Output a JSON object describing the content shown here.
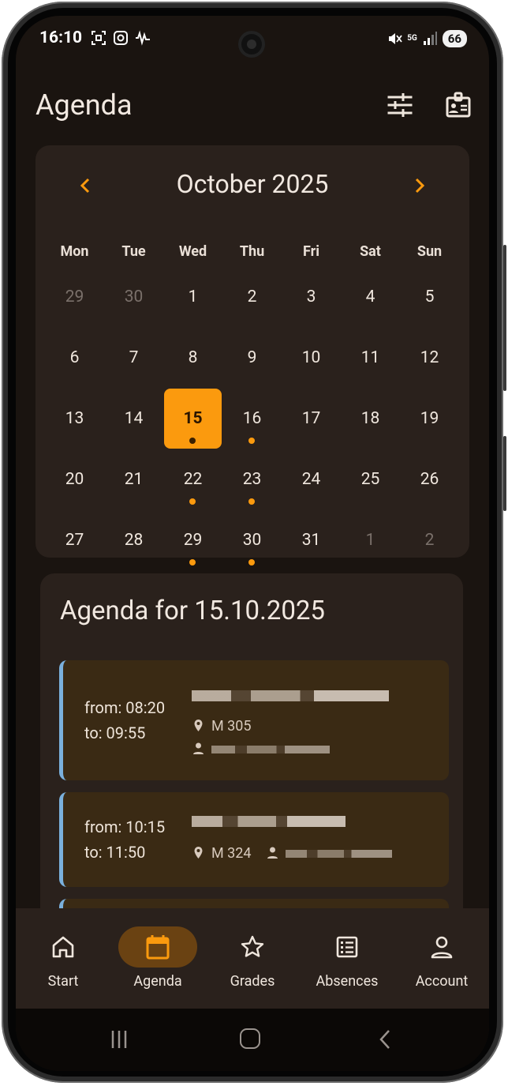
{
  "status_bar": {
    "time": "16:10",
    "network": "5G",
    "battery": "66"
  },
  "app_bar": {
    "title": "Agenda",
    "filter_icon": "tune-icon",
    "profile_icon": "badge-icon"
  },
  "calendar": {
    "month_label": "October 2025",
    "weekdays": [
      "Mon",
      "Tue",
      "Wed",
      "Thu",
      "Fri",
      "Sat",
      "Sun"
    ],
    "days": [
      {
        "label": "29",
        "muted": true
      },
      {
        "label": "30",
        "muted": true
      },
      {
        "label": "1"
      },
      {
        "label": "2"
      },
      {
        "label": "3"
      },
      {
        "label": "4"
      },
      {
        "label": "5"
      },
      {
        "label": "6"
      },
      {
        "label": "7"
      },
      {
        "label": "8"
      },
      {
        "label": "9"
      },
      {
        "label": "10"
      },
      {
        "label": "11"
      },
      {
        "label": "12"
      },
      {
        "label": "13"
      },
      {
        "label": "14"
      },
      {
        "label": "15",
        "selected": true,
        "event": true
      },
      {
        "label": "16",
        "event": true
      },
      {
        "label": "17"
      },
      {
        "label": "18"
      },
      {
        "label": "19"
      },
      {
        "label": "20"
      },
      {
        "label": "21"
      },
      {
        "label": "22",
        "event": true
      },
      {
        "label": "23",
        "event": true
      },
      {
        "label": "24"
      },
      {
        "label": "25"
      },
      {
        "label": "26"
      },
      {
        "label": "27"
      },
      {
        "label": "28"
      },
      {
        "label": "29",
        "event": true
      },
      {
        "label": "30",
        "event": true
      },
      {
        "label": "31"
      },
      {
        "label": "1",
        "muted": true
      },
      {
        "label": "2",
        "muted": true
      }
    ]
  },
  "agenda": {
    "title": "Agenda for 15.10.2025",
    "events": [
      {
        "from": "from: 08:20",
        "to": "to: 09:55",
        "room": "M 305"
      },
      {
        "from": "from: 10:15",
        "to": "to: 11:50",
        "room": "M 324"
      }
    ]
  },
  "bottom_nav": {
    "items": [
      {
        "label": "Start",
        "icon": "home-icon"
      },
      {
        "label": "Agenda",
        "icon": "calendar-icon",
        "active": true
      },
      {
        "label": "Grades",
        "icon": "star-icon"
      },
      {
        "label": "Absences",
        "icon": "list-icon"
      },
      {
        "label": "Account",
        "icon": "person-icon"
      }
    ]
  },
  "colors": {
    "accent": "#fb9a0e",
    "event_border": "#7ab0dc",
    "surface": "#2a211c",
    "background": "#1a1410"
  }
}
